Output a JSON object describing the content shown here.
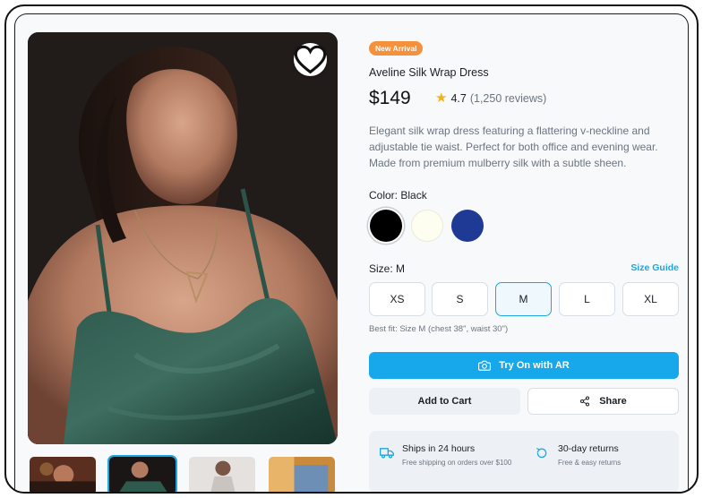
{
  "product": {
    "badge": "New Arrival",
    "title": "Aveline Silk Wrap Dress",
    "price": "$149",
    "rating": "4.7",
    "reviews": "(1,250 reviews)",
    "description": "Elegant silk wrap dress featuring a flattering v-neckline and adjustable tie waist. Perfect for both office and evening wear. Made from premium mulberry silk with a subtle sheen."
  },
  "color": {
    "label": "Color: Black",
    "swatches": [
      {
        "name": "Black",
        "hex": "#000000",
        "selected": true
      },
      {
        "name": "Cream",
        "hex": "#fdfdf0",
        "selected": false
      },
      {
        "name": "Navy",
        "hex": "#1e3a95",
        "selected": false
      }
    ]
  },
  "size": {
    "label": "Size: M",
    "guide": "Size Guide",
    "options": [
      "XS",
      "S",
      "M",
      "L",
      "XL"
    ],
    "selected": "M",
    "fit_note": "Best fit: Size M (chest 38\", waist 30\")"
  },
  "actions": {
    "try_on": "Try On with AR",
    "add_to_cart": "Add to Cart",
    "share": "Share"
  },
  "info": {
    "shipping_title": "Ships in 24 hours",
    "shipping_sub": "Free shipping on orders over $100",
    "returns_title": "30-day returns",
    "returns_sub": "Free & easy returns"
  },
  "colors": {
    "accent": "#17a8ec",
    "badge": "#f5913d",
    "star": "#f2b01e"
  },
  "icons": {
    "wishlist": "heart-icon",
    "try_on": "camera-icon",
    "share": "share-icon",
    "shipping": "truck-icon",
    "returns": "refresh-icon"
  }
}
